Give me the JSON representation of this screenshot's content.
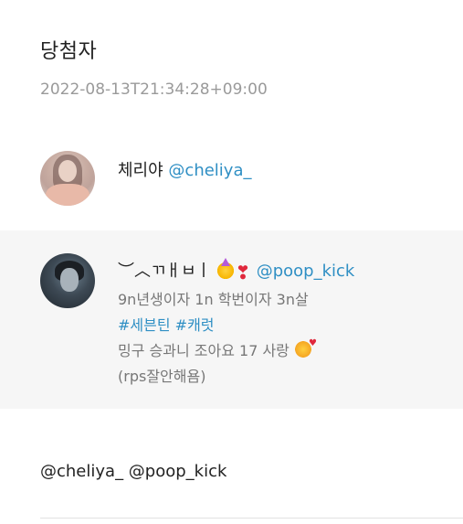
{
  "title": "당첨자",
  "timestamp": "2022-08-13T21:34:28+09:00",
  "winners": [
    {
      "name": "체리야",
      "handle": "@cheliya_"
    },
    {
      "name": "︶︿ㄲㅐㅂㅣ",
      "emojis": [
        "party-face-icon",
        "heart-exclamation-icon"
      ],
      "handle": "@poop_kick",
      "bio_line1": "9n년생이자 1n 학번이자 3n살",
      "hashtag1": "#세븐틴",
      "hashtag2": "#캐럿",
      "bio_line3": "밍구 승과니 조아요 17 사랑",
      "bio_line4": "(rps잘안해욤)"
    }
  ],
  "mentions": "@cheliya_ @poop_kick",
  "colors": {
    "link": "#2f8fc4",
    "card_bg": "#f6f6f6",
    "muted": "#9a9a9a"
  }
}
